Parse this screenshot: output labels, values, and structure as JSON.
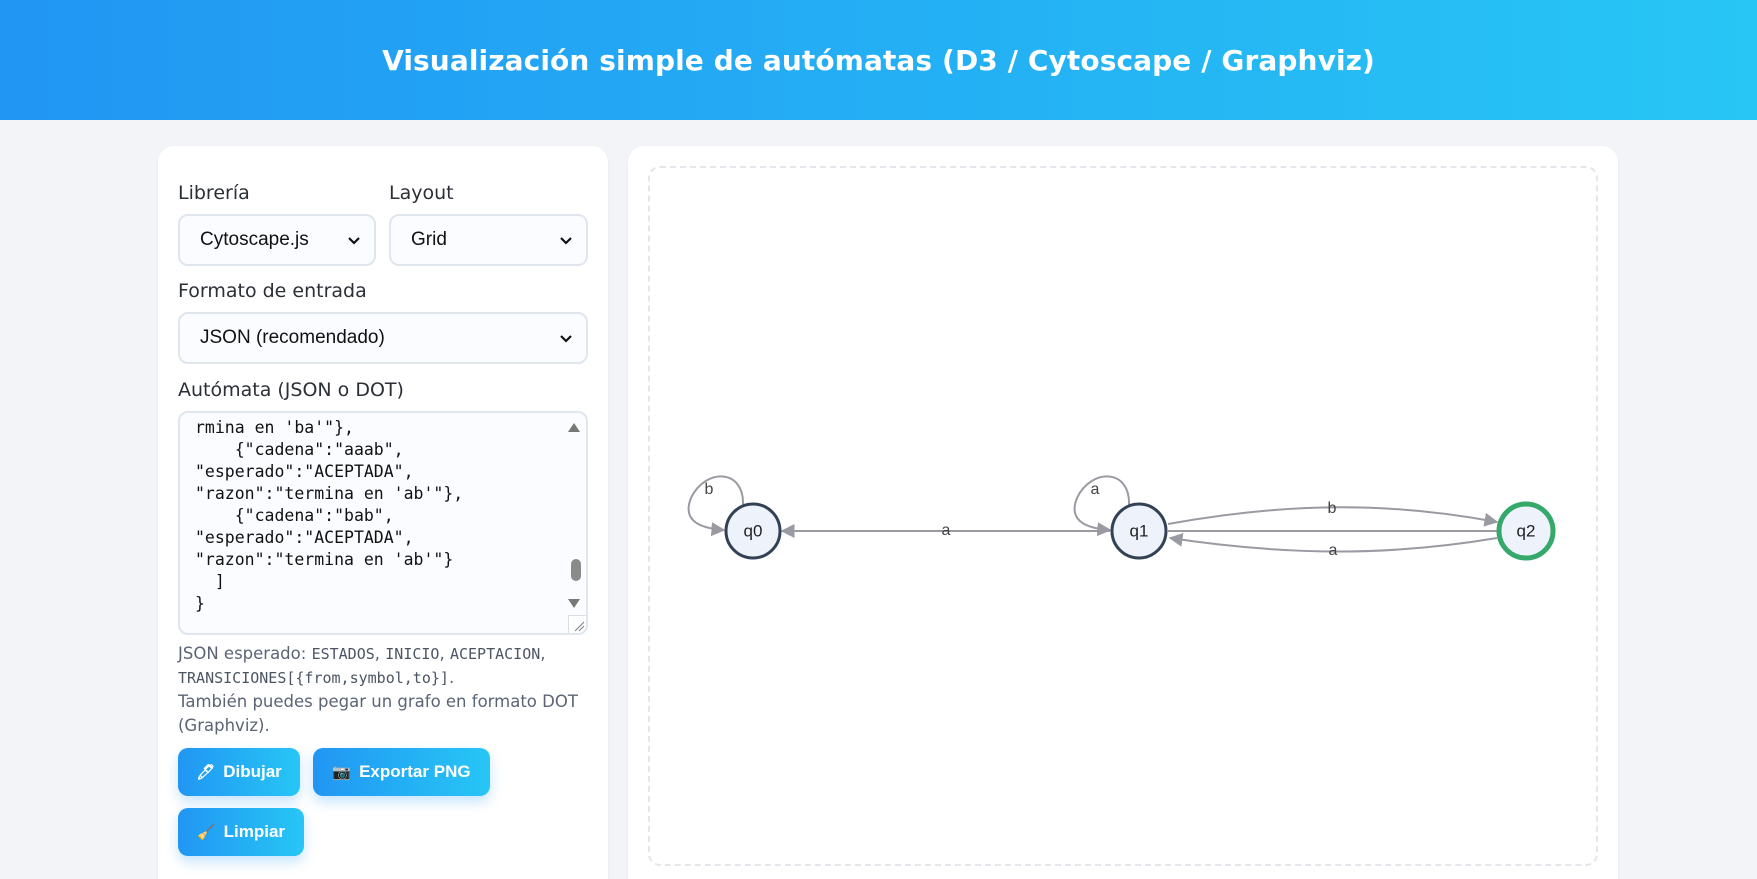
{
  "header": {
    "title": "Visualización simple de autómatas (D3 / Cytoscape / Graphviz)"
  },
  "controls": {
    "library": {
      "label": "Librería",
      "value": "Cytoscape.js"
    },
    "layout": {
      "label": "Layout",
      "value": "Grid"
    },
    "format": {
      "label": "Formato de entrada",
      "value": "JSON (recomendado)"
    },
    "automaton": {
      "label": "Autómata (JSON o DOT)",
      "text": "rmina en 'ba'\"},\n    {\"cadena\":\"aaab\",\n\"esperado\":\"ACEPTADA\",\n\"razon\":\"termina en 'ab'\"},\n    {\"cadena\":\"bab\",\n\"esperado\":\"ACEPTADA\",\n\"razon\":\"termina en 'ab'\"}\n  ]\n}"
    },
    "help": {
      "prefix": "JSON esperado: ",
      "code1": "ESTADOS",
      "sep1": ", ",
      "code2": "INICIO",
      "sep2": ", ",
      "code3": "ACEPTACION",
      "sep3": ",",
      "code4": "TRANSICIONES[{from,symbol,to}]",
      "end": ".",
      "line2": "También puedes pegar un grafo en formato DOT (Graphviz)."
    },
    "buttons": {
      "draw": {
        "icon": "🖊",
        "label": "Dibujar"
      },
      "export": {
        "icon": "📷",
        "label": "Exportar PNG"
      },
      "clear": {
        "icon": "🧹",
        "label": "Limpiar"
      }
    }
  },
  "graph": {
    "nodes": [
      {
        "id": "q0",
        "label": "q0",
        "accepting": false
      },
      {
        "id": "q1",
        "label": "q1",
        "accepting": false
      },
      {
        "id": "q2",
        "label": "q2",
        "accepting": true
      }
    ],
    "edges": [
      {
        "from": "q0",
        "symbol": "b",
        "to": "q0"
      },
      {
        "from": "q1",
        "symbol": "a",
        "to": "q0"
      },
      {
        "from": "q1",
        "symbol": "a",
        "to": "q1"
      },
      {
        "from": "q1",
        "symbol": "b",
        "to": "q2"
      },
      {
        "from": "q2",
        "symbol": "a",
        "to": "q1"
      }
    ],
    "colors": {
      "node_fill": "#eef2fb",
      "node_stroke": "#334155",
      "accept_stroke": "#35a86b",
      "edge": "#9a9aa3",
      "label": "#444"
    }
  }
}
